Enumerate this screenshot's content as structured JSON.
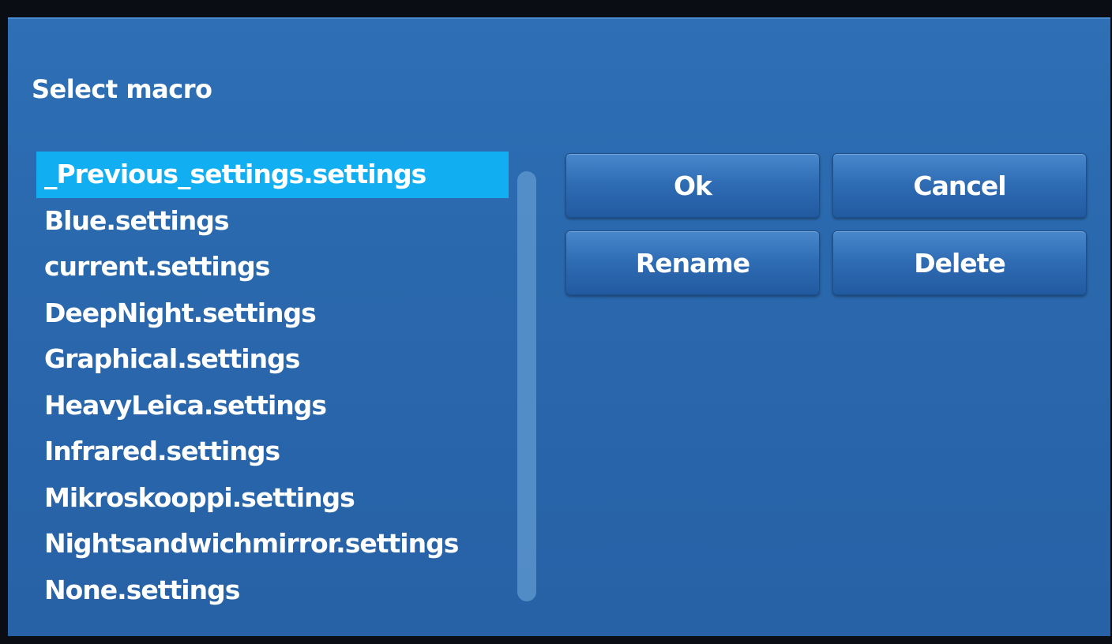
{
  "dialog": {
    "title": "Select macro"
  },
  "macros": {
    "items": [
      "_Previous_settings.settings",
      "Blue.settings",
      "current.settings",
      "DeepNight.settings",
      "Graphical.settings",
      "HeavyLeica.settings",
      "Infrared.settings",
      "Mikroskooppi.settings",
      "Nightsandwichmirror.settings",
      "None.settings"
    ],
    "selected": "_Previous_settings.settings"
  },
  "buttons": {
    "ok": "Ok",
    "cancel": "Cancel",
    "rename": "Rename",
    "delete": "Delete"
  },
  "colors": {
    "background": "#2b69ae",
    "selection": "#12aef2",
    "text": "#ffffff"
  }
}
